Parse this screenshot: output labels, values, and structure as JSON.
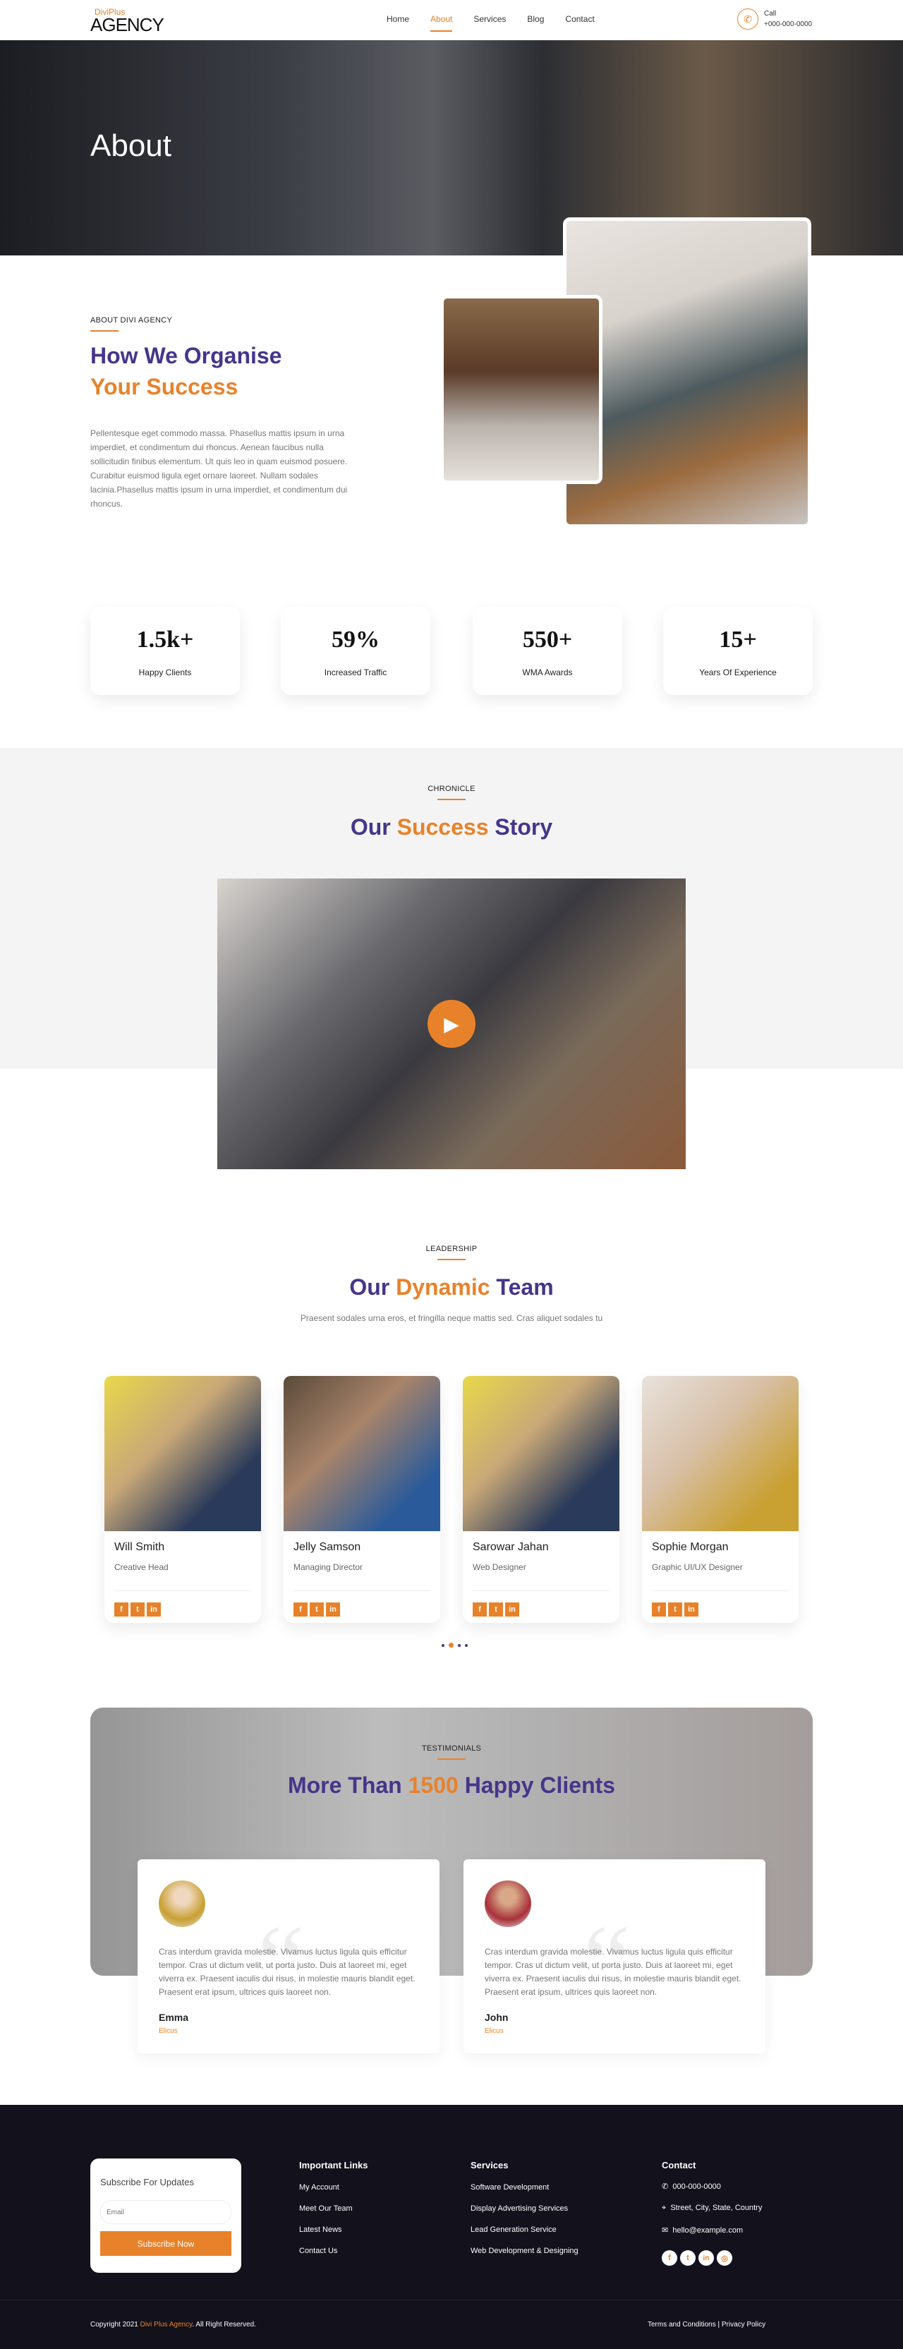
{
  "header": {
    "logo_top": "DiviPlus",
    "logo_main": "AGENCY",
    "nav": [
      "Home",
      "About",
      "Services",
      "Blog",
      "Contact"
    ],
    "active": "About",
    "call_label": "Call",
    "call_number": "+000-000-0000"
  },
  "hero": {
    "title": "About"
  },
  "about": {
    "label": "ABOUT DIVI AGENCY",
    "title_1": "How We Organise",
    "title_2": "Your Success",
    "text": "Pellentesque eget commodo massa. Phasellus mattis ipsum in urna imperdiet, et condimentum dui rhoncus. Aenean faucibus nulla sollicitudin finibus elementum. Ut quis leo in quam euismod posuere. Curabitur euismod ligula eget ornare laoreet. Nullam sodales lacinia.Phasellus mattis ipsum in urna imperdiet, et condimentum dui rhoncus."
  },
  "stats": [
    {
      "value": "1.5k+",
      "label": "Happy Clients"
    },
    {
      "value": "59%",
      "label": "Increased Traffic"
    },
    {
      "value": "550+",
      "label": "WMA Awards"
    },
    {
      "value": "15+",
      "label": "Years Of Experience"
    }
  ],
  "chronicle": {
    "label": "CHRONICLE",
    "title_a": "Our ",
    "title_b": "Success",
    "title_c": " Story"
  },
  "leadership": {
    "label": "LEADERSHIP",
    "title_a": "Our ",
    "title_b": "Dynamic",
    "title_c": " Team",
    "text": "Praesent sodales urna eros, et fringilla neque mattis sed. Cras aliquet sodales tu"
  },
  "team": [
    {
      "name": "Will Smith",
      "role": "Creative Head"
    },
    {
      "name": "Jelly Samson",
      "role": "Managing Director"
    },
    {
      "name": "Sarowar Jahan",
      "role": "Web Designer"
    },
    {
      "name": "Sophie Morgan",
      "role": "Graphic UI/UX Designer"
    }
  ],
  "social": [
    "f",
    "t",
    "in"
  ],
  "carousel": {
    "dots": 4,
    "active": 1
  },
  "testimonials": {
    "label": "TESTIMONIALS",
    "title_a": "More Than ",
    "title_b": "1500",
    "title_c": " Happy Clients",
    "items": [
      {
        "text": "Cras interdum gravida molestie. Vivamus luctus ligula quis efficitur tempor. Cras ut dictum velit, ut porta justo. Duis at laoreet mi, eget viverra ex. Praesent iaculis dui risus, in molestie mauris blandit eget. Praesent erat ipsum, ultrices quis laoreet non.",
        "name": "Emma",
        "role": "Elicus"
      },
      {
        "text": "Cras interdum gravida molestie. Vivamus luctus ligula quis efficitur tempor. Cras ut dictum velit, ut porta justo. Duis at laoreet mi, eget viverra ex. Praesent iaculis dui risus, in molestie mauris blandit eget. Praesent erat ipsum, ultrices quis laoreet non.",
        "name": "John",
        "role": "Elicus"
      }
    ]
  },
  "footer": {
    "subscribe_title": "Subscribe For Updates",
    "email_placeholder": "Email",
    "subscribe_button": "Subscribe Now",
    "links_title": "Important Links",
    "links": [
      "My Account",
      "Meet Our Team",
      "Latest News",
      "Contact Us"
    ],
    "services_title": "Services",
    "services": [
      "Software Development",
      "Display Advertising Services",
      "Lead Generation Service",
      "Web Development & Designing"
    ],
    "contact_title": "Contact",
    "phone": "000-000-0000",
    "address": "Street, City, State, Country",
    "email": "hello@example.com",
    "copyright_a": "Copyright 2021 ",
    "copyright_brand": "Divi Plus Agency",
    "copyright_b": ". All Right Reserved.",
    "terms": "Terms and Conditions",
    "sep": "|",
    "privacy": "Privacy Policy"
  },
  "colors": {
    "accent": "#e8822a",
    "brand": "#46358a",
    "footer_bg": "#12111c"
  }
}
